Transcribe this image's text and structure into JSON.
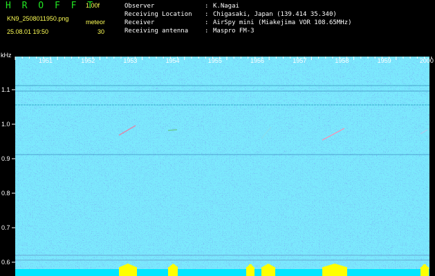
{
  "header": {
    "app_title": "H R O F F T",
    "version": "1.00f",
    "filename": "KN9_2508011950.png",
    "meteor_label": "meteor",
    "datetime": "25.08.01 19:50",
    "meteor_count": "30",
    "info": [
      {
        "key": "Observer",
        "value": "K.Nagai"
      },
      {
        "key": "Receiving Location",
        "value": "Chigasaki, Japan (139.414 35.340)"
      },
      {
        "key": "Receiver",
        "value": "AirSpy mini (Miakejima VOR 108.65MHz)"
      },
      {
        "key": "Receiving antenna",
        "value": "Maspro FM-3"
      }
    ]
  },
  "spectrogram": {
    "y_unit": "kHz",
    "y_ticks": [
      "1.1",
      "1.0",
      "0.9",
      "0.8",
      "0.7",
      "0.6"
    ],
    "x_ticks": [
      "1951",
      "1952",
      "1953",
      "1954",
      "1955",
      "1956",
      "1957",
      "1958",
      "1959",
      "2000"
    ]
  },
  "colors": {
    "background": "#000000",
    "spectrogram_base": "#0a1a8c",
    "header_green": "#22e622",
    "header_yellow": "#ffff55",
    "signal_line": "#33bbcc",
    "level_bar": "#00e5ff",
    "level_peak": "#ffff00"
  }
}
